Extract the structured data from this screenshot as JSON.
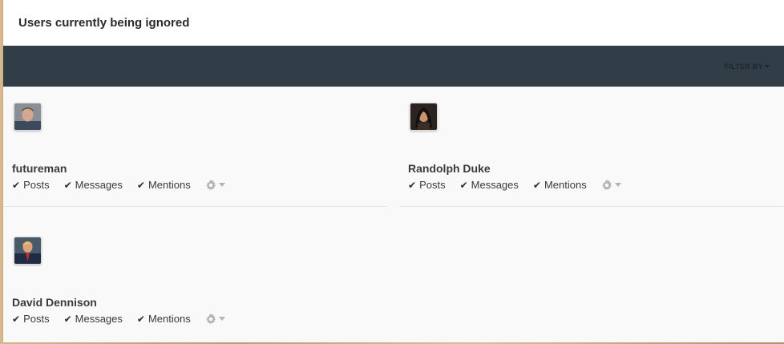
{
  "panel": {
    "title": "Users currently being ignored"
  },
  "filter": {
    "label": "FILTER BY"
  },
  "users": [
    {
      "name": "futureman",
      "options": [
        "Posts",
        "Messages",
        "Mentions"
      ]
    },
    {
      "name": "Randolph Duke",
      "options": [
        "Posts",
        "Messages",
        "Mentions"
      ]
    },
    {
      "name": "David Dennison",
      "options": [
        "Posts",
        "Messages",
        "Mentions"
      ]
    }
  ],
  "icons": {
    "check": "check-icon",
    "settings": "gear-icon",
    "dropdown": "chevron-down-icon"
  },
  "colors": {
    "filter_bar": "#323e47",
    "panel_bg": "#f9f9f9",
    "text": "#3a3a3a"
  }
}
